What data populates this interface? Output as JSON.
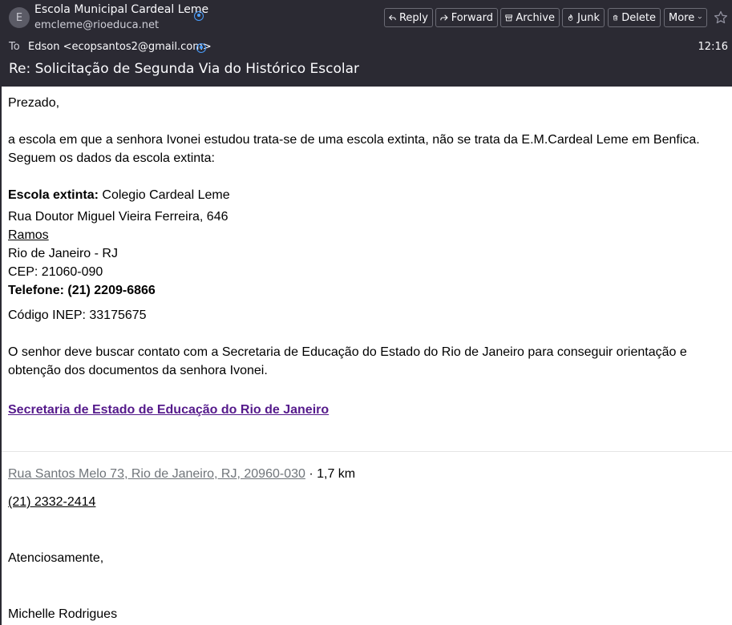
{
  "header": {
    "avatar_letter": "E",
    "from_name": "Escola Municipal Cardeal Leme",
    "from_email": "emcleme@rioeduca.net",
    "to_label": "To",
    "to_value": "Edson <ecopsantos2@gmail.com>",
    "time": "12:16",
    "subject": "Re: Solicitação de Segunda Via do Histórico Escolar"
  },
  "toolbar": {
    "reply": "Reply",
    "forward": "Forward",
    "archive": "Archive",
    "junk": "Junk",
    "delete": "Delete",
    "more": "More"
  },
  "body": {
    "greeting": "Prezado,",
    "para1_line1": "a escola em que a senhora Ivonei estudou trata-se de uma escola extinta, não se trata da E.M.Cardeal Leme em Benfica.",
    "para1_line2": "Seguem os dados da escola extinta:",
    "extinct_label": "Escola extinta:",
    "extinct_value": " Colegio Cardeal Leme",
    "address_street": "Rua Doutor Miguel Vieira Ferreira, 646",
    "address_district": "Ramos",
    "address_city": "Rio de Janeiro - RJ",
    "address_cep": "CEP: 21060-090",
    "phone": "Telefone: (21) 2209-6866",
    "inep": "Código INEP: 33175675",
    "para2_line1": "O senhor deve buscar contato com a Secretaria de Educação do Estado do Rio de Janeiro para conseguir orientação e",
    "para2_line2": "obtenção dos documentos da senhora Ivonei.",
    "secretaria_link": "Secretaria de Estado de Educação do Rio de Janeiro",
    "map_address": "Rua Santos Melo 73, Rio de Janeiro, RJ, 20960-030",
    "map_distance": " · 1,7 km",
    "map_phone": "(21) 2332-2414",
    "closing": "Atenciosamente,",
    "signature": "Michelle Rodrigues"
  },
  "colors": {
    "header_bg": "#2b2a33",
    "link_visited": "#551a8b",
    "contact_icon": "#4a9eff"
  }
}
